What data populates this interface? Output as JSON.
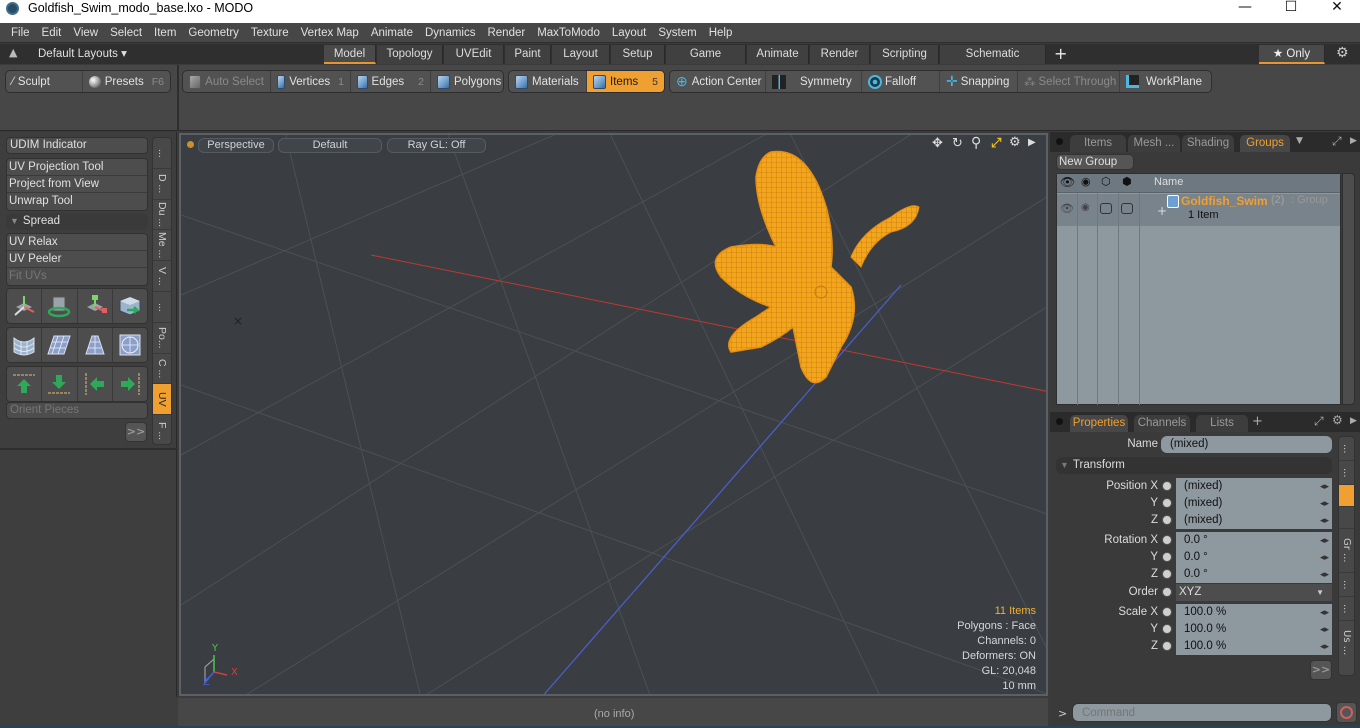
{
  "window": {
    "title": "Goldfish_Swim_modo_base.lxo - MODO",
    "minimize": "—",
    "maximize": "☐",
    "close": "✕"
  },
  "menu": [
    "File",
    "Edit",
    "View",
    "Select",
    "Item",
    "Geometry",
    "Texture",
    "Vertex Map",
    "Animate",
    "Dynamics",
    "Render",
    "MaxToModo",
    "Layout",
    "System",
    "Help"
  ],
  "layoutbar": {
    "default_layouts": "Default Layouts ▾",
    "tabs": [
      "Model",
      "Topology",
      "UVEdit",
      "Paint",
      "Layout",
      "Setup",
      "Game Tools",
      "Animate",
      "Render",
      "Scripting",
      "Schematic Fusion"
    ],
    "active_tab": "Model",
    "add": "+",
    "only": "★ Only"
  },
  "toolbar": {
    "sculpt": "Sculpt",
    "presets": "Presets",
    "presets_key": "F6",
    "auto_select": "Auto Select",
    "vertices": "Vertices",
    "vertices_key": "1",
    "edges": "Edges",
    "edges_key": "2",
    "polygons": "Polygons",
    "materials": "Materials",
    "items": "Items",
    "items_key": "5",
    "action_center": "Action Center",
    "symmetry": "Symmetry",
    "falloff": "Falloff",
    "snapping": "Snapping",
    "select_through": "Select Through",
    "workplane": "WorkPlane"
  },
  "leftpanel": {
    "udim": "UDIM Indicator",
    "group1": [
      "UV Projection Tool",
      "Project from View",
      "Unwrap Tool"
    ],
    "spread": "Spread",
    "group2": [
      "UV Relax",
      "UV Peeler",
      "Fit UVs"
    ],
    "orient": "Orient Pieces",
    "more": ">>",
    "vtabs": [
      "...",
      "D ...",
      "Du ...",
      "Me ...",
      "V ...",
      "...",
      "Po...",
      "C ...",
      "UV",
      "F ..."
    ],
    "active_vtab": "UV"
  },
  "viewport": {
    "view": "Perspective",
    "shading": "Default",
    "raygl": "Ray GL: Off",
    "info": {
      "items": "11 Items",
      "polygons": "Polygons : Face",
      "channels": "Channels: 0",
      "deformers": "Deformers: ON",
      "gl": "GL: 20,048",
      "scale": "10 mm"
    },
    "axis_x": "X",
    "axis_y": "Y",
    "axis_z": "Z"
  },
  "groups_panel": {
    "tabs": [
      "Items",
      "Mesh ...",
      "Shading",
      "Groups"
    ],
    "active_tab": "Groups",
    "new_group": "New Group",
    "col_name": "Name",
    "row": {
      "name": "Goldfish_Swim",
      "count": "(2)",
      "type": ": Group",
      "sub": "1 Item"
    }
  },
  "properties": {
    "tabs": [
      "Properties",
      "Channels",
      "Lists"
    ],
    "active_tab": "Properties",
    "add": "+",
    "name_label": "Name",
    "name_value": "(mixed)",
    "section": "Transform",
    "rows": [
      {
        "label": "Position X",
        "value": "(mixed)"
      },
      {
        "label": "Y",
        "value": "(mixed)"
      },
      {
        "label": "Z",
        "value": "(mixed)"
      },
      {
        "label": "Rotation X",
        "value": "0.0 °"
      },
      {
        "label": "Y",
        "value": "0.0 °"
      },
      {
        "label": "Z",
        "value": "0.0 °"
      },
      {
        "label": "Order",
        "value": "XYZ"
      },
      {
        "label": "Scale X",
        "value": "100.0 %"
      },
      {
        "label": "Y",
        "value": "100.0 %"
      },
      {
        "label": "Z",
        "value": "100.0 %"
      }
    ],
    "more": ">>",
    "side_tabs": [
      "...",
      "...",
      "",
      "Gr ...",
      "...",
      "...",
      "Us ..."
    ]
  },
  "status": {
    "info": "(no info)",
    "command_placeholder": "Command",
    "prompt": ">"
  },
  "colors": {
    "accent": "#f0a030",
    "viewport_bg": "#3a3e42",
    "x_axis": "#d33b2f",
    "z_axis": "#4a5fc9"
  }
}
